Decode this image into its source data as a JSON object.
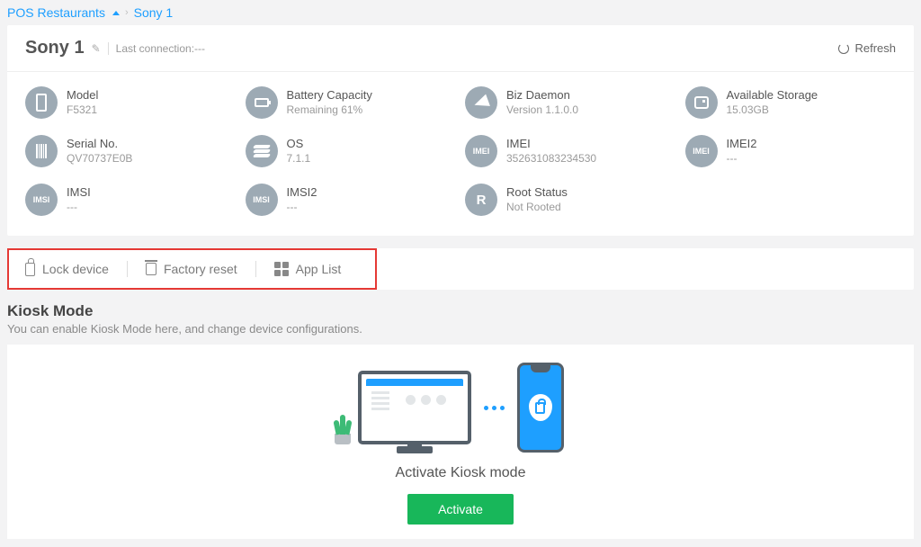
{
  "breadcrumb": {
    "parent": "POS Restaurants",
    "current": "Sony 1"
  },
  "device": {
    "name": "Sony 1",
    "last_connection_label": "Last connection:---",
    "refresh": "Refresh"
  },
  "info": {
    "model": {
      "label": "Model",
      "value": "F5321"
    },
    "battery": {
      "label": "Battery Capacity",
      "value": "Remaining 61%"
    },
    "bizdaemon": {
      "label": "Biz Daemon",
      "value": "Version 1.1.0.0"
    },
    "storage": {
      "label": "Available Storage",
      "value": "15.03GB"
    },
    "serial": {
      "label": "Serial No.",
      "value": "QV70737E0B"
    },
    "os": {
      "label": "OS",
      "value": "7.1.1"
    },
    "imei": {
      "label": "IMEI",
      "value": "352631083234530"
    },
    "imei2": {
      "label": "IMEI2",
      "value": "---"
    },
    "imsi": {
      "label": "IMSI",
      "value": "---"
    },
    "imsi2": {
      "label": "IMSI2",
      "value": "---"
    },
    "root": {
      "label": "Root Status",
      "value": "Not Rooted"
    }
  },
  "actions": {
    "lock": "Lock device",
    "factory": "Factory reset",
    "applist": "App List"
  },
  "kiosk": {
    "heading": "Kiosk Mode",
    "subtext": "You can enable Kiosk Mode here, and change device configurations.",
    "title": "Activate Kiosk mode",
    "button": "Activate"
  },
  "badges": {
    "imei": "IMEI",
    "imsi": "IMSI",
    "r": "R"
  }
}
